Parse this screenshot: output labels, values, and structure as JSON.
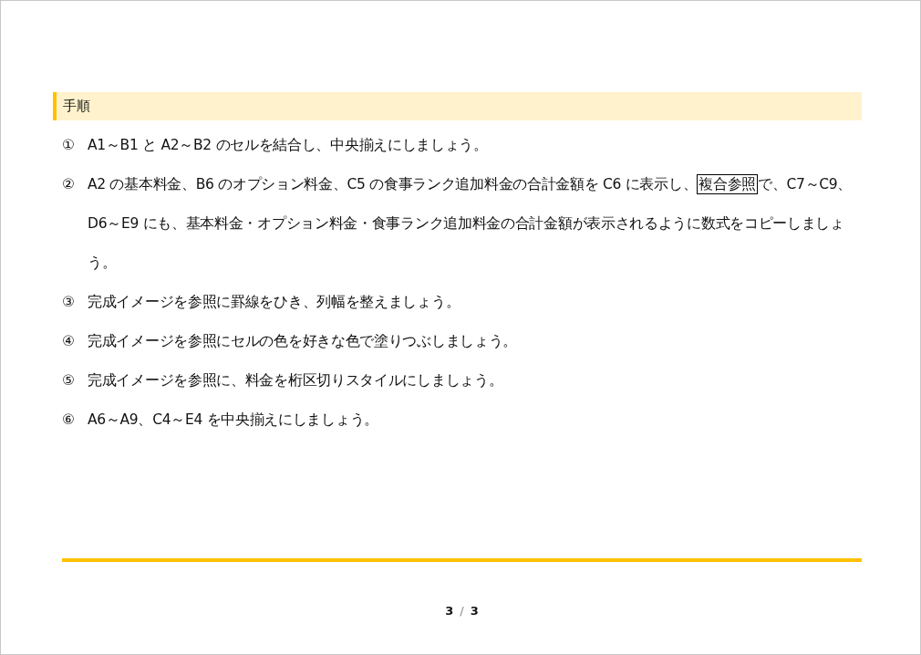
{
  "section": {
    "title": "手順"
  },
  "steps": [
    {
      "number": "①",
      "segments": [
        {
          "text": "A1～B1 と A2～B2 のセルを結合し、中央揃えにしましょう。",
          "boxed": false
        }
      ]
    },
    {
      "number": "②",
      "segments": [
        {
          "text": "A2 の基本料金、B6 のオプション料金、C5 の食事ランク追加料金の合計金額を C6 に表示し、",
          "boxed": false
        },
        {
          "text": "複合参照",
          "boxed": true
        },
        {
          "text": "で、C7～C9、D6～E9 にも、基本料金・オプション料金・食事ランク追加料金の合計金額が表示されるように数式をコピーしましょう。",
          "boxed": false
        }
      ]
    },
    {
      "number": "③",
      "segments": [
        {
          "text": "完成イメージを参照に罫線をひき、列幅を整えましょう。",
          "boxed": false
        }
      ]
    },
    {
      "number": "④",
      "segments": [
        {
          "text": "完成イメージを参照にセルの色を好きな色で塗りつぶしましょう。",
          "boxed": false
        }
      ]
    },
    {
      "number": "⑤",
      "segments": [
        {
          "text": "完成イメージを参照に、料金を桁区切りスタイルにしましょう。",
          "boxed": false
        }
      ]
    },
    {
      "number": "⑥",
      "segments": [
        {
          "text": "A6～A9、C4～E4 を中央揃えにしましょう。",
          "boxed": false
        }
      ]
    }
  ],
  "footer": {
    "current": "3",
    "separator": "/",
    "total": "3"
  }
}
